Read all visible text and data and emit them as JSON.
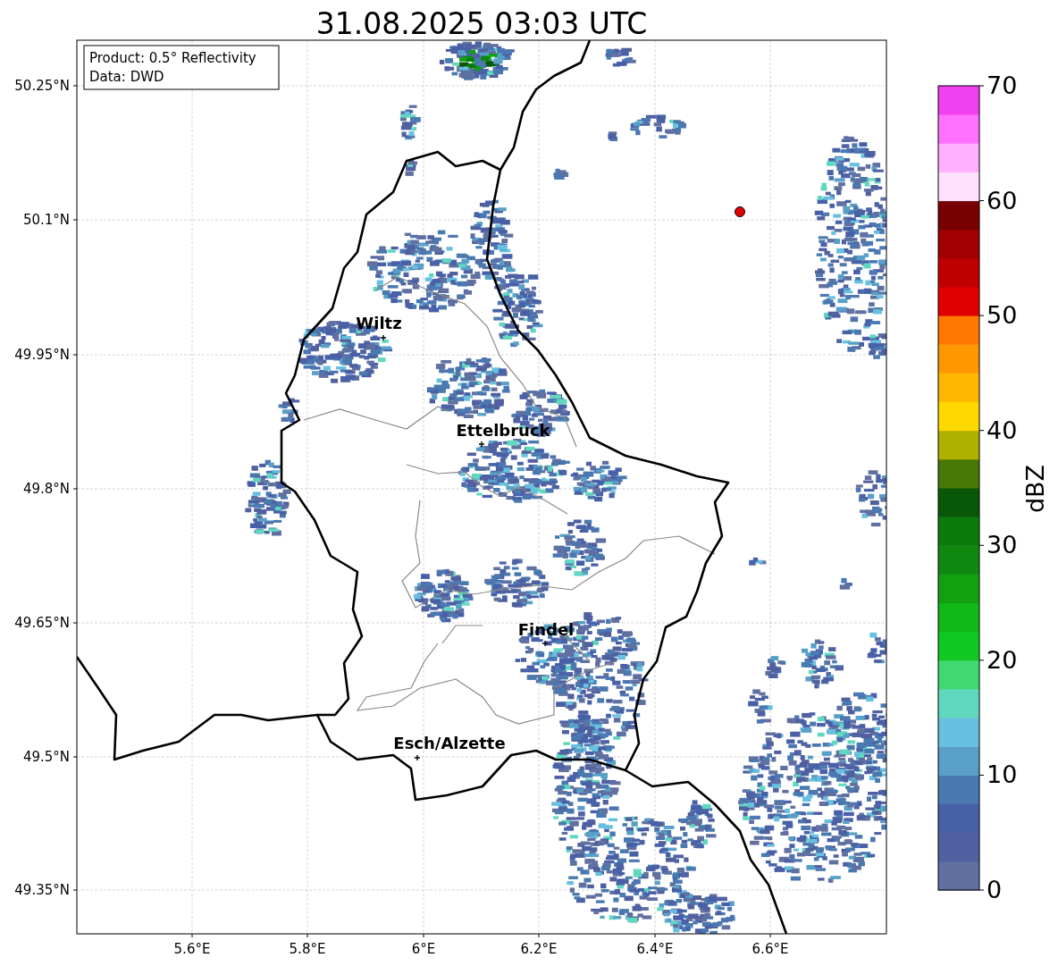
{
  "title": "31.08.2025 03:03 UTC",
  "info_box": {
    "lines": [
      "Product: 0.5° Reflectivity",
      "Data: DWD"
    ]
  },
  "map": {
    "xticks": [
      "5.6°E",
      "5.8°E",
      "6°E",
      "6.2°E",
      "6.4°E",
      "6.6°E"
    ],
    "yticks": [
      "50.25°N",
      "50.1°N",
      "49.95°N",
      "49.8°N",
      "49.65°N",
      "49.5°N",
      "49.35°N"
    ],
    "cities": [
      {
        "name": "Wiltz"
      },
      {
        "name": "Ettelbruck"
      },
      {
        "name": "Findel"
      },
      {
        "name": "Esch/Alzette"
      }
    ],
    "radar_site": {
      "color": "#e00000"
    }
  },
  "colorbar": {
    "label": "dBZ",
    "ticks": [
      "70",
      "60",
      "50",
      "40",
      "30",
      "20",
      "10",
      "0"
    ],
    "bins": [
      {
        "color": "#6070a0"
      },
      {
        "color": "#5060a0"
      },
      {
        "color": "#4860a8"
      },
      {
        "color": "#4a78b0"
      },
      {
        "color": "#58a0c8"
      },
      {
        "color": "#68c0e0"
      },
      {
        "color": "#60d8c0"
      },
      {
        "color": "#40d870"
      },
      {
        "color": "#10c820"
      },
      {
        "color": "#10b818"
      },
      {
        "color": "#10a010"
      },
      {
        "color": "#108810"
      },
      {
        "color": "#0a7a0a"
      },
      {
        "color": "#085808"
      },
      {
        "color": "#487808"
      },
      {
        "color": "#b0b000"
      },
      {
        "color": "#ffd800"
      },
      {
        "color": "#ffb800"
      },
      {
        "color": "#ff9800"
      },
      {
        "color": "#ff7800"
      },
      {
        "color": "#e00000"
      },
      {
        "color": "#c00000"
      },
      {
        "color": "#a00000"
      },
      {
        "color": "#780000"
      },
      {
        "color": "#ffe0ff"
      },
      {
        "color": "#ffb0ff"
      },
      {
        "color": "#ff70ff"
      },
      {
        "color": "#f040f0"
      }
    ]
  }
}
